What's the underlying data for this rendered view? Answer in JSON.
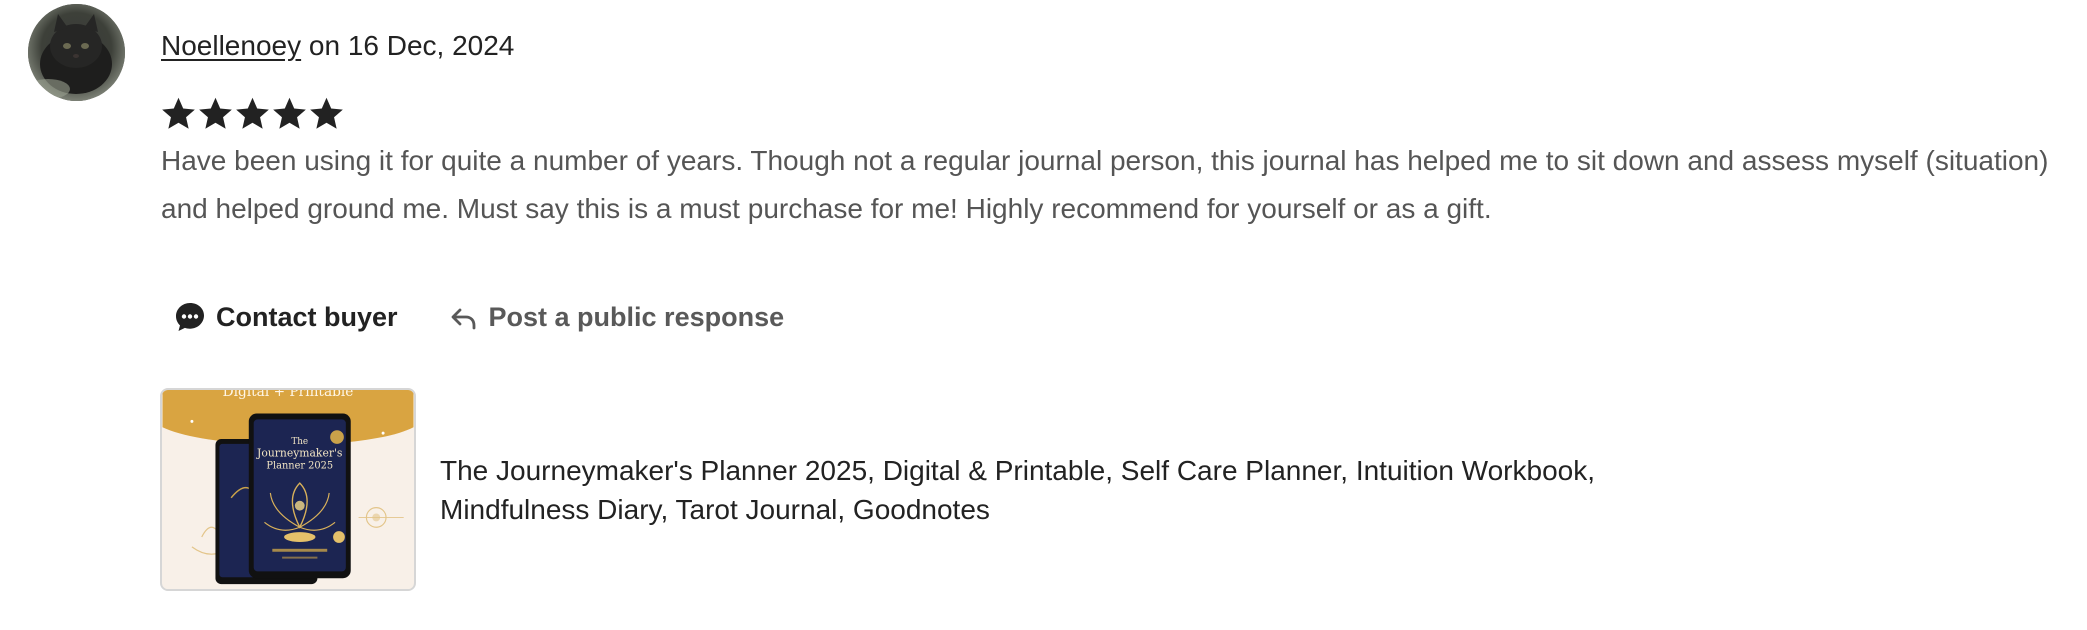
{
  "review": {
    "username": "Noellenoey",
    "date_text": " on 16 Dec, 2024",
    "rating": 5,
    "rating_max": 5,
    "star_color": "#222222",
    "text": "Have been using it for quite a number of years. Though not a regular journal person, this journal has helped me to sit down and assess myself (situation) and helped ground me. Must say this is a must purchase for me! Highly recommend for yourself or as a gift."
  },
  "actions": {
    "contact_label": "Contact buyer",
    "contact_icon": "chat-bubble-icon",
    "respond_label": "Post a public response",
    "respond_icon": "reply-arrow-icon"
  },
  "product": {
    "title": "The Journeymaker's Planner 2025, Digital & Printable, Self Care Planner, Intuition Workbook, Mindfulness Diary, Tarot Journal, Goodnotes",
    "thumbnail_banner": "Digital + Printable",
    "thumbnail_book_title_line1": "The",
    "thumbnail_book_title_line2": "Journeymaker's",
    "thumbnail_book_title_line3": "Planner 2025",
    "accent_color": "#d9a441",
    "cover_color": "#1c2552"
  }
}
